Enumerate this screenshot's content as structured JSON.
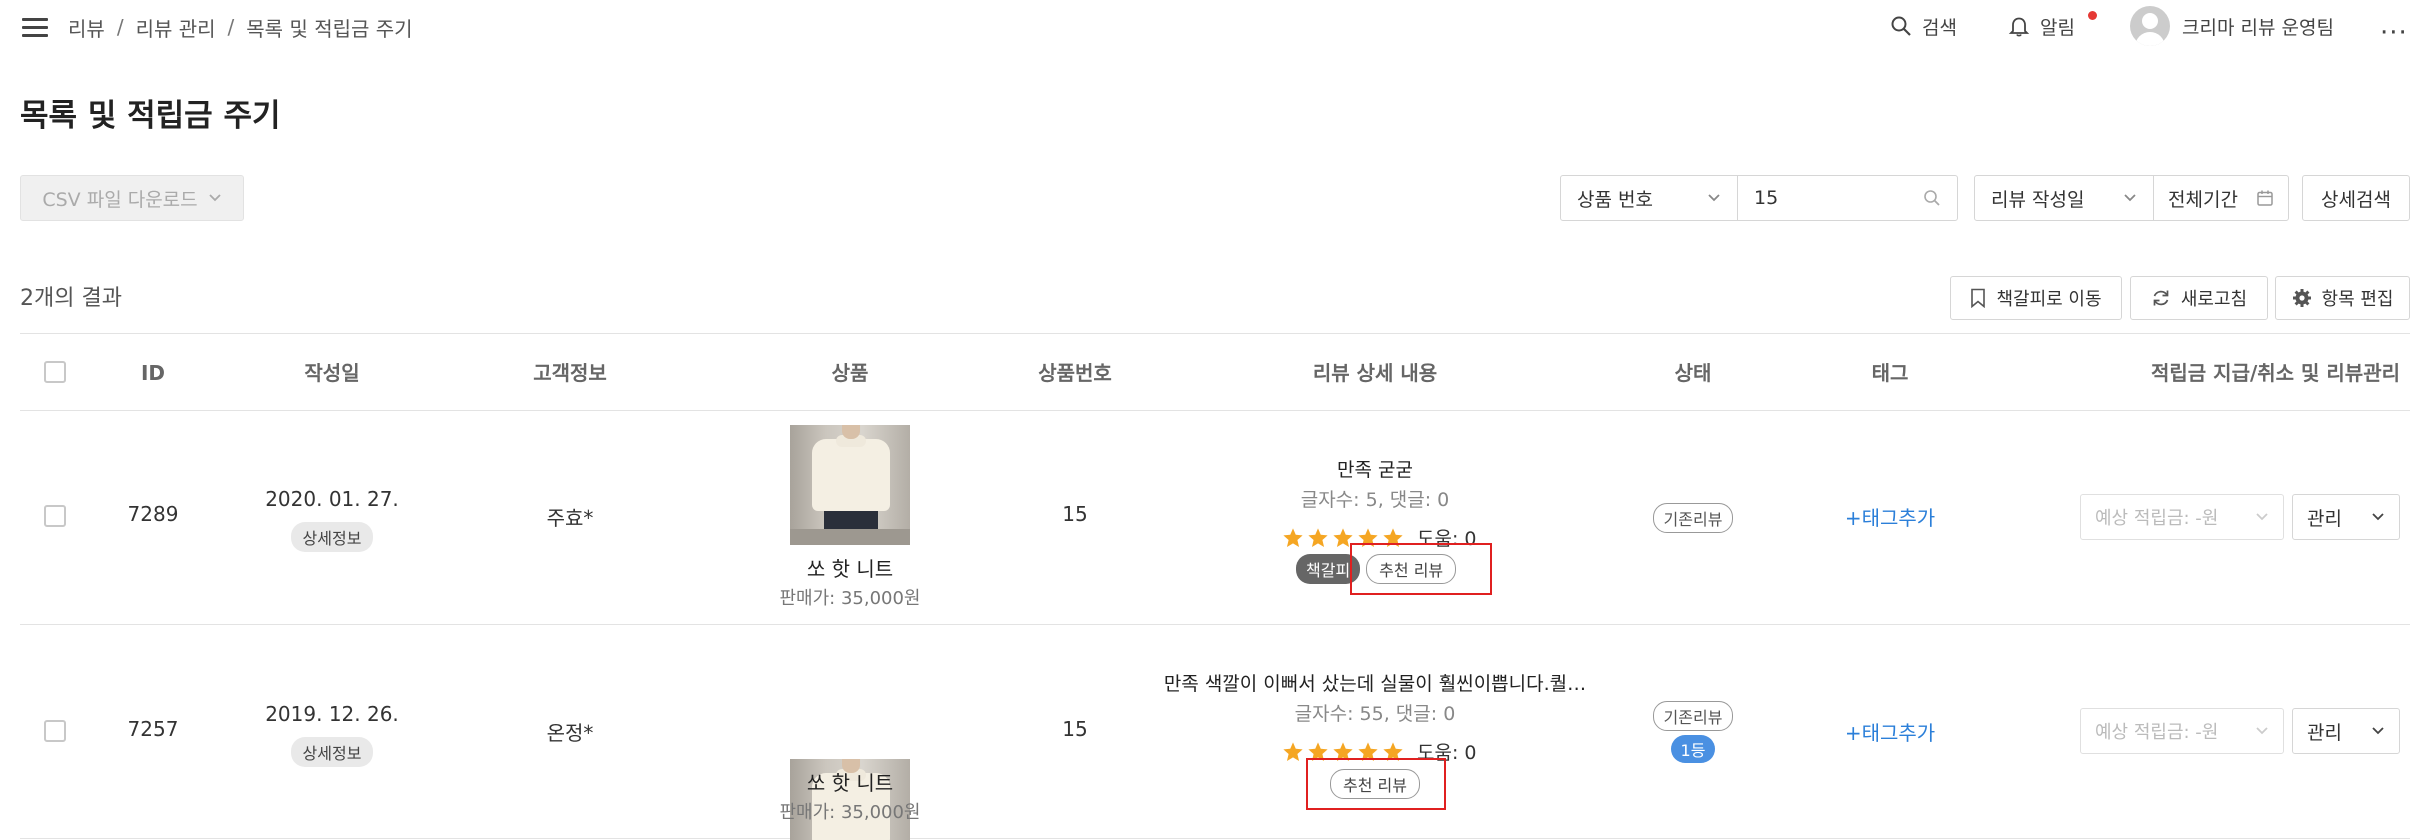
{
  "topbar": {
    "breadcrumb": [
      "리뷰",
      "리뷰 관리",
      "목록 및 적립금 주기"
    ],
    "search_label": "검색",
    "alert_label": "알림",
    "user_name": "크리마 리뷰 운영팀",
    "more_label": "···",
    "menu_icon": "hamburger-icon"
  },
  "page": {
    "title": "목록 및 적립금 주기"
  },
  "toolbar": {
    "csv_label": "CSV 파일 다운로드",
    "product_filter": "상품 번호",
    "product_value": "15",
    "date_filter": "리뷰 작성일",
    "period_label": "전체기간",
    "advanced_label": "상세검색"
  },
  "results": {
    "count_label": "2개의 결과",
    "bookmark_label": "책갈피로 이동",
    "refresh_label": "새로고침",
    "edit_columns_label": "항목 편집"
  },
  "table": {
    "headers": [
      "ID",
      "작성일",
      "고객정보",
      "상품",
      "상품번호",
      "리뷰 상세 내용",
      "상태",
      "태그",
      "적립금 지급/취소 및 리뷰관리"
    ],
    "rows": [
      {
        "id": "7289",
        "date": "2020. 01. 27.",
        "detail_badge": "상세정보",
        "customer": "주효*",
        "product_name": "쏘 핫 니트",
        "product_price": "판매가: 35,000원",
        "product_no": "15",
        "review_title": "만족 굳굳",
        "review_meta": "글자수: 5, 댓글: 0",
        "rating": 5,
        "helpful": "도움: 0",
        "tag_dark": "책갈피",
        "tag_outline": "추천 리뷰",
        "status": "기존리뷰",
        "rank": "",
        "add_tag": "+태그추가",
        "expected": "예상 적립금: -원",
        "manage": "관리"
      },
      {
        "id": "7257",
        "date": "2019. 12. 26.",
        "detail_badge": "상세정보",
        "customer": "온정*",
        "product_name": "쏘 핫 니트",
        "product_price": "판매가: 35,000원",
        "product_no": "15",
        "review_title": "만족 색깔이 이뻐서 샀는데 실물이 훨씬이쁩니다.퀄…",
        "review_meta": "글자수: 55, 댓글: 0",
        "rating": 5,
        "helpful": "도움: 0",
        "tag_dark": "",
        "tag_outline": "추천 리뷰",
        "status": "기존리뷰",
        "rank": "1등",
        "add_tag": "+태그추가",
        "expected": "예상 적립금: -원",
        "manage": "관리"
      }
    ]
  },
  "colors": {
    "accent_blue": "#2b7fd9",
    "star": "#f5a623",
    "highlight_red": "#e02020",
    "alert_dot": "#e53935"
  }
}
